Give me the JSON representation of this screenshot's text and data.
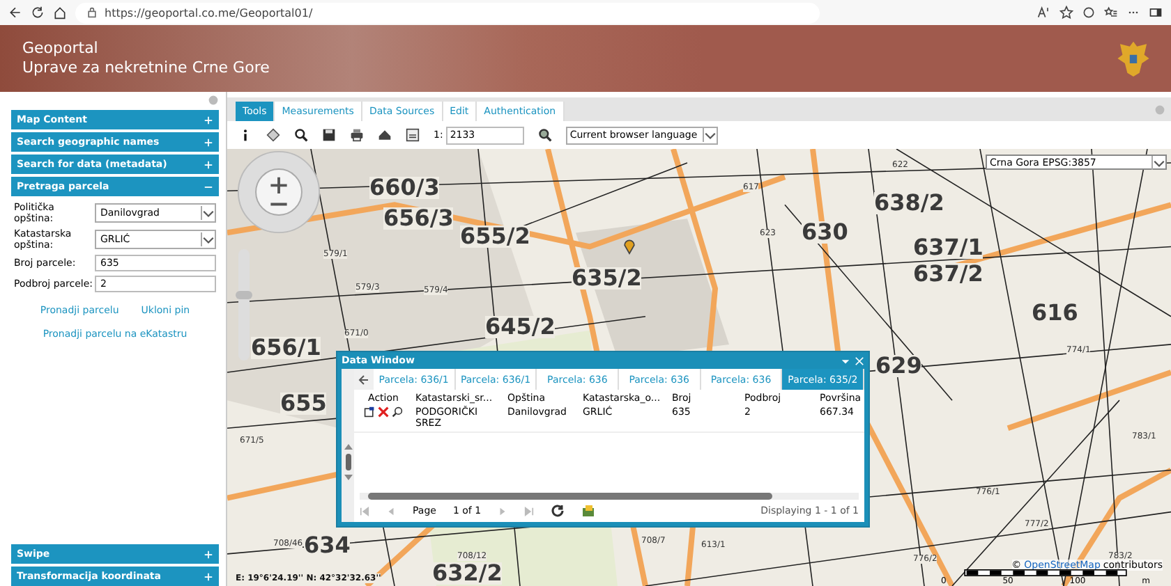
{
  "browser": {
    "url": "https://geoportal.co.me/Geoportal01/"
  },
  "header": {
    "title": "Geoportal",
    "subtitle": "Uprave za nekretnine Crne Gore"
  },
  "sidebar": {
    "sections": [
      {
        "title": "Map Content",
        "expanded": false
      },
      {
        "title": "Search geographic names",
        "expanded": false
      },
      {
        "title": "Search for data (metadata)",
        "expanded": false
      },
      {
        "title": "Pretraga parcela",
        "expanded": true
      }
    ],
    "form": {
      "fields": [
        {
          "label": "Politička opština:",
          "kind": "select",
          "value": "Danilovgrad"
        },
        {
          "label": "Katastarska opština:",
          "kind": "select",
          "value": "GRLIĆ"
        },
        {
          "label": "Broj parcele:",
          "kind": "text",
          "value": "635"
        },
        {
          "label": "Podbroj parcele:",
          "kind": "text",
          "value": "2"
        }
      ],
      "links": [
        "Pronadji parcelu",
        "Ukloni pin"
      ],
      "link_wide": "Pronadji parcelu na eKatastru"
    },
    "bottom_sections": [
      {
        "title": "Swipe",
        "expanded": false
      },
      {
        "title": "Transformacija koordinata",
        "expanded": false
      }
    ]
  },
  "toolbar": {
    "tabs": [
      {
        "label": "Tools",
        "selected": true
      },
      {
        "label": "Measurements",
        "selected": false
      },
      {
        "label": "Data Sources",
        "selected": false
      },
      {
        "label": "Edit",
        "selected": false
      },
      {
        "label": "Authentication",
        "selected": false
      }
    ],
    "scale_prefix": "1:",
    "scale": "2133",
    "language": "Current browser language"
  },
  "map": {
    "projection": "Crna Gora EPSG:3857",
    "labels": [
      {
        "text": "660/3",
        "kind": "large"
      },
      {
        "text": "656/3",
        "kind": "large"
      },
      {
        "text": "655/2",
        "kind": "large"
      },
      {
        "text": "635/2",
        "kind": "large"
      },
      {
        "text": "630",
        "kind": "large"
      },
      {
        "text": "638/2",
        "kind": "large"
      },
      {
        "text": "637/1",
        "kind": "large"
      },
      {
        "text": "637/2",
        "kind": "large"
      },
      {
        "text": "616",
        "kind": "large"
      },
      {
        "text": "629",
        "kind": "large"
      },
      {
        "text": "656/1",
        "kind": "large"
      },
      {
        "text": "655",
        "kind": "large"
      },
      {
        "text": "645/2",
        "kind": "large"
      },
      {
        "text": "634",
        "kind": "large"
      },
      {
        "text": "632/2",
        "kind": "large"
      },
      {
        "text": "622",
        "kind": "small"
      },
      {
        "text": "617",
        "kind": "small"
      },
      {
        "text": "623",
        "kind": "small"
      },
      {
        "text": "579/1",
        "kind": "small"
      },
      {
        "text": "579/3",
        "kind": "small"
      },
      {
        "text": "579/4",
        "kind": "small"
      },
      {
        "text": "671/0",
        "kind": "small"
      },
      {
        "text": "774/1",
        "kind": "small"
      },
      {
        "text": "783/1",
        "kind": "small"
      },
      {
        "text": "776/1",
        "kind": "small"
      },
      {
        "text": "777/2",
        "kind": "small"
      },
      {
        "text": "783/2",
        "kind": "small"
      },
      {
        "text": "776/2",
        "kind": "small"
      },
      {
        "text": "708/46",
        "kind": "small"
      },
      {
        "text": "708/7",
        "kind": "small"
      },
      {
        "text": "613/1",
        "kind": "small"
      },
      {
        "text": "708/12",
        "kind": "small"
      },
      {
        "text": "671/5",
        "kind": "small"
      }
    ],
    "zoom": {
      "level": 0.6
    },
    "coordinates": "E: 19°6'24.19''  N: 42°32'32.63''",
    "attribution_prefix": "©",
    "attribution_link": "OpenStreetMap",
    "attribution_suffix": "contributors",
    "scale_ticks": [
      "0",
      "50",
      "100",
      "m"
    ]
  },
  "data_window": {
    "title": "Data Window",
    "tabs": [
      {
        "label": "Parcela: 636/1",
        "selected": false
      },
      {
        "label": "Parcela: 636/1",
        "selected": false
      },
      {
        "label": "Parcela: 636",
        "selected": false
      },
      {
        "label": "Parcela: 636",
        "selected": false
      },
      {
        "label": "Parcela: 636",
        "selected": false
      },
      {
        "label": "Parcela: 635/2",
        "selected": true
      }
    ],
    "columns": [
      "Action",
      "Katastarski_sr...",
      "Opština",
      "Katastarska_o...",
      "Broj",
      "Podbroj",
      "Površina"
    ],
    "rows": [
      [
        "",
        "PODGORIČKI SREZ",
        "Danilovgrad",
        "GRLIĆ",
        "635",
        "2",
        "667.34"
      ]
    ],
    "paging": {
      "page_label": "Page",
      "page": "1 of 1",
      "summary": "Displaying 1 - 1 of 1"
    }
  }
}
